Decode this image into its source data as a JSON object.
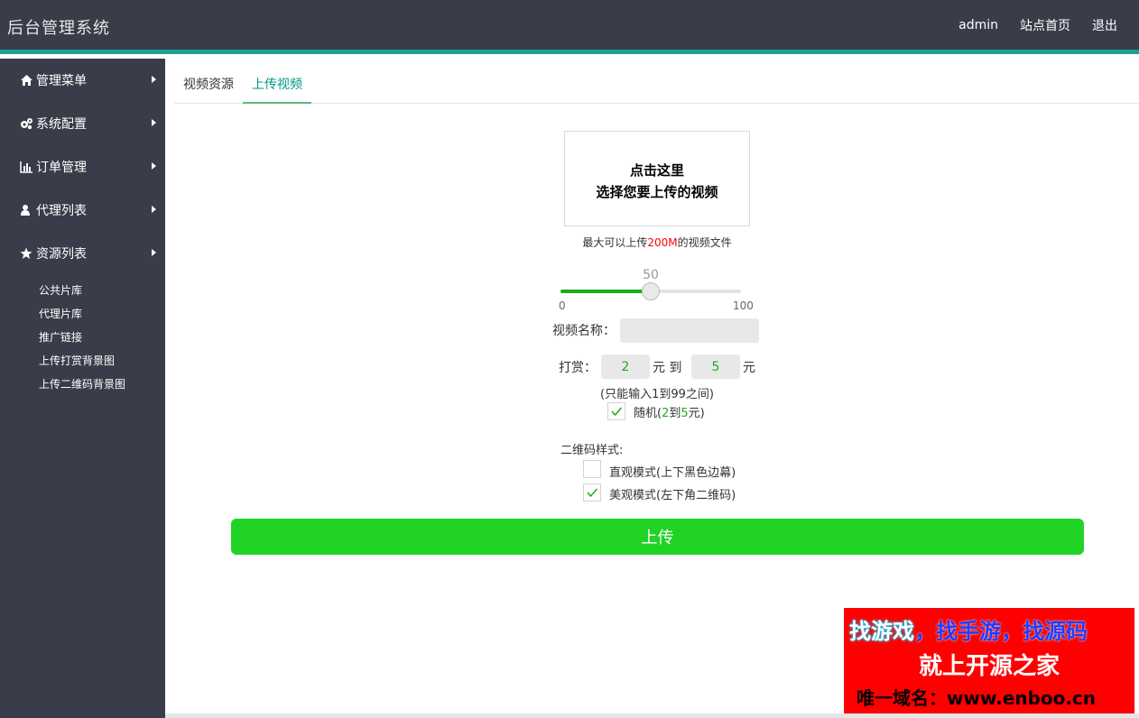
{
  "header": {
    "title": "后台管理系统",
    "nav": [
      "admin",
      "站点首页",
      "退出"
    ]
  },
  "sidebar": {
    "menu": [
      {
        "label": "管理菜单",
        "icon": "home-icon"
      },
      {
        "label": "系统配置",
        "icon": "gears-icon"
      },
      {
        "label": "订单管理",
        "icon": "bar-chart-icon"
      },
      {
        "label": "代理列表",
        "icon": "user-icon"
      },
      {
        "label": "资源列表",
        "icon": "star-icon"
      }
    ],
    "submenu": [
      "公共片库",
      "代理片库",
      "推广链接",
      "上传打赏背景图",
      "上传二维码背景图"
    ]
  },
  "tabs": [
    {
      "label": "视频资源",
      "active": false
    },
    {
      "label": "上传视频",
      "active": true
    }
  ],
  "upload": {
    "box_line1": "点击这里",
    "box_line2": "选择您要上传的视频",
    "hint_prefix": "最大可以上传",
    "hint_size": "200M",
    "hint_suffix": "的视频文件"
  },
  "slider": {
    "value": "50",
    "min": "0",
    "max": "100",
    "fraction": 0.5
  },
  "form": {
    "name_label": "视频名称：",
    "name_value": "",
    "reward_label": "打赏：",
    "reward_min": "2",
    "reward_to": "元 到",
    "reward_max": "5",
    "reward_unit": "元",
    "note": "(只能输入1到99之间)",
    "random_prefix": "随机(",
    "random_min": "2",
    "random_mid": "到",
    "random_max": "5",
    "random_suffix": "元)",
    "random_checked": true,
    "qr_label": "二维码样式:",
    "qr_options": [
      {
        "label": "直观模式(上下黑色边幕)",
        "checked": false
      },
      {
        "label": "美观模式(左下角二维码)",
        "checked": true
      }
    ]
  },
  "submit_label": "上传",
  "promo": {
    "part1": "找游戏",
    "comma1": "，",
    "part2": "找手游",
    "comma2": "，",
    "part3": "找源码",
    "line2": "就上开源之家",
    "line3": "唯一域名：www.enboo.cn"
  },
  "colors": {
    "header_bg": "#393d49",
    "accent": "#1aa094",
    "button": "#21d324",
    "slider_fill": "#1aad19"
  }
}
